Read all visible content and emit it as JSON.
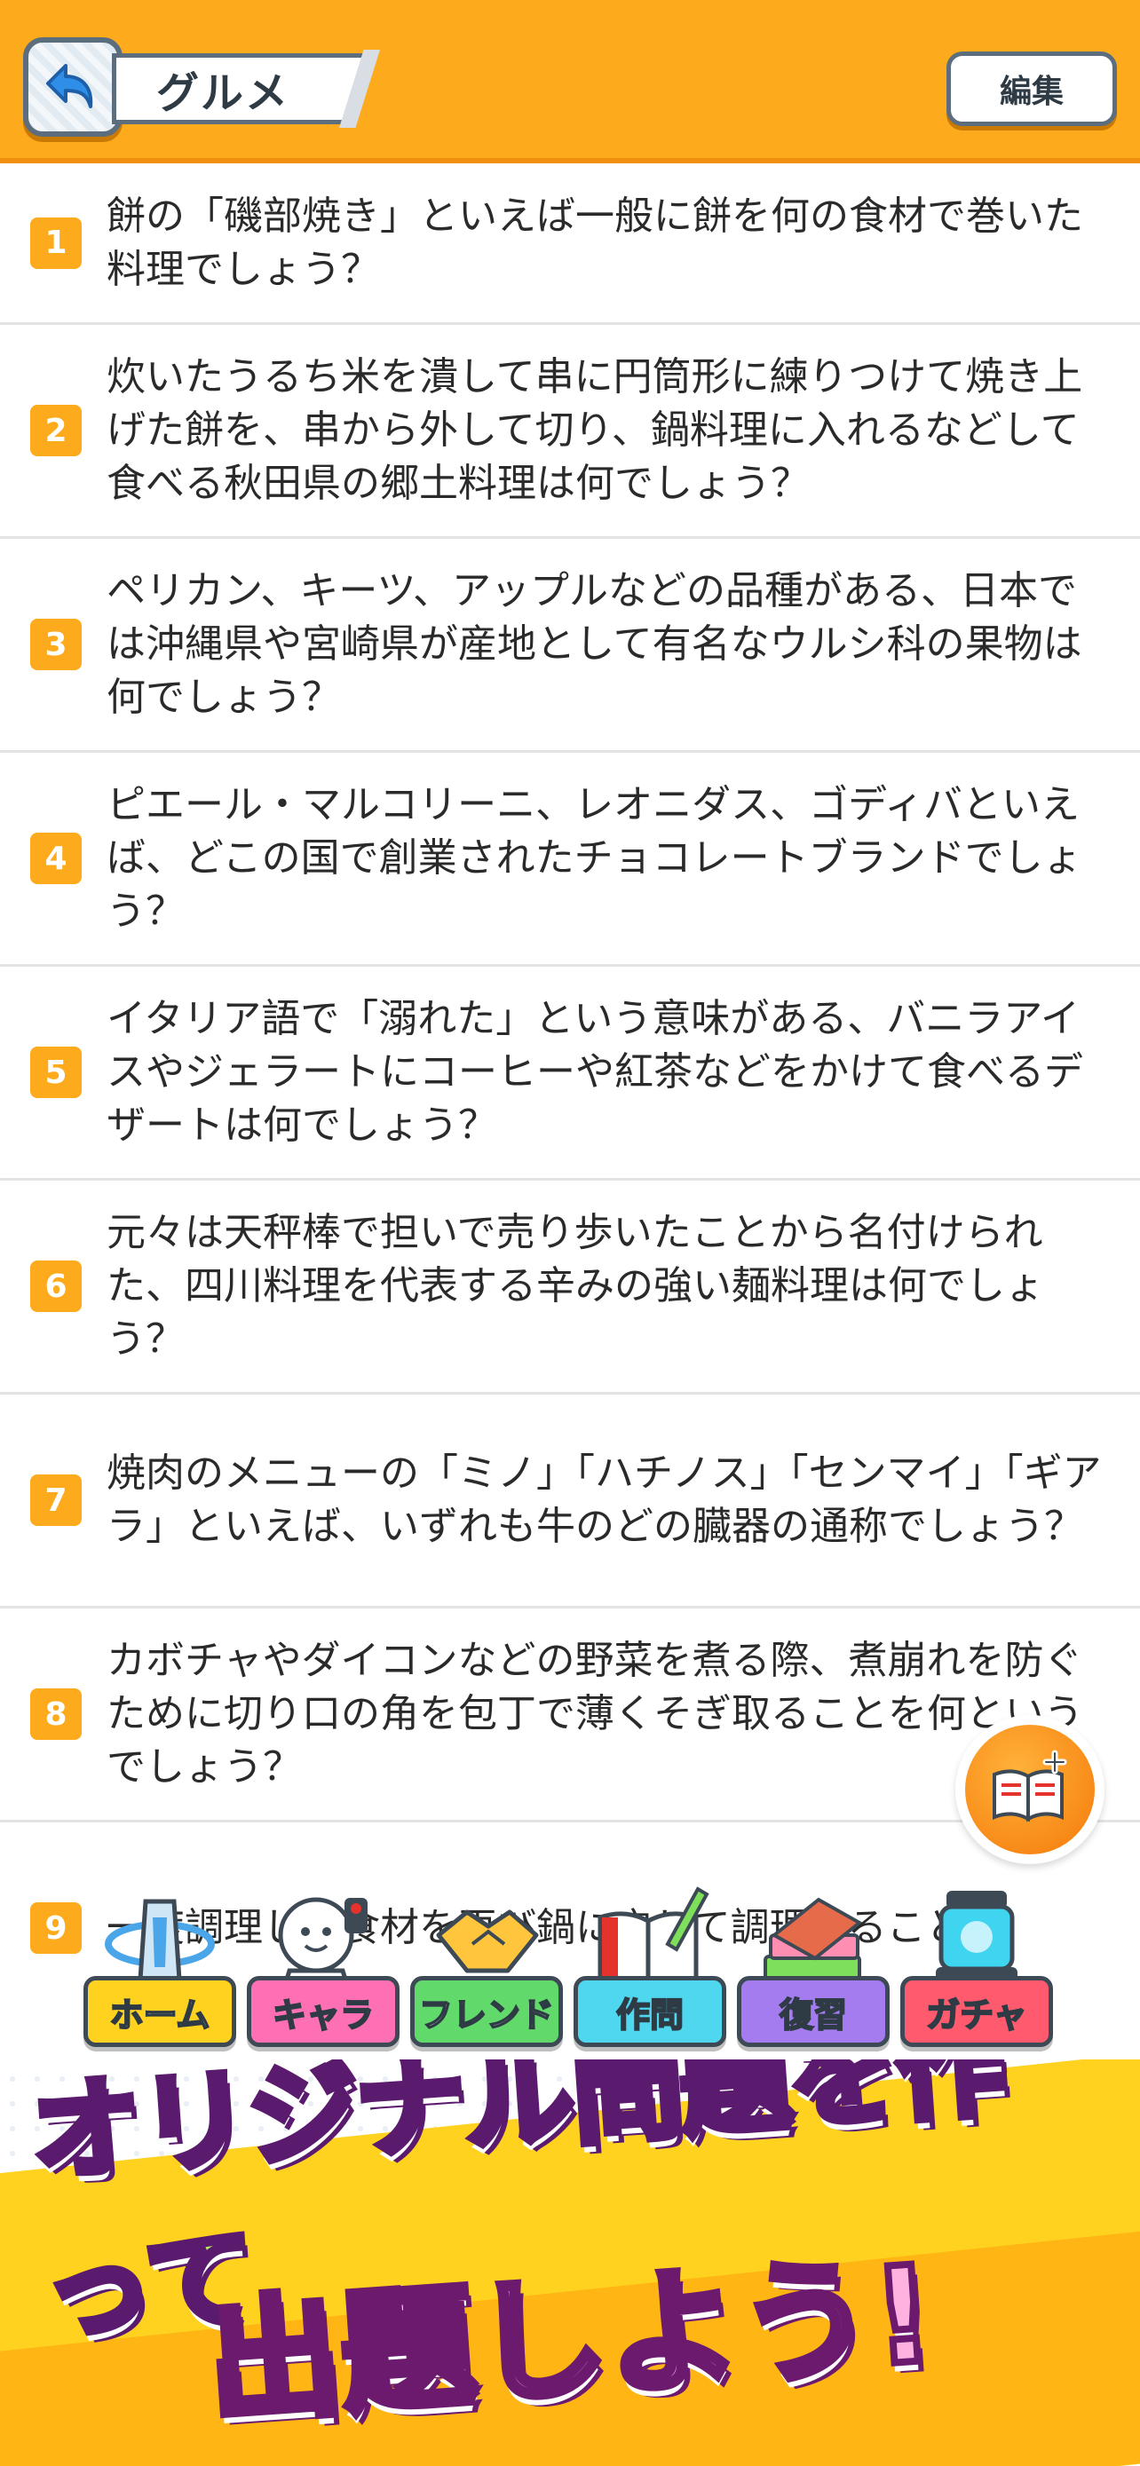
{
  "header": {
    "title": "グルメ",
    "edit_label": "編集"
  },
  "questions": [
    {
      "num": "1",
      "text": "餅の「磯部焼き」といえば一般に餅を何の食材で巻いた料理でしょう？"
    },
    {
      "num": "2",
      "text": "炊いたうるち米を潰して串に円筒形に練りつけて焼き上げた餅を、串から外して切り、鍋料理に入れるなどして食べる秋田県の郷土料理は何でしょう？"
    },
    {
      "num": "3",
      "text": "ペリカン、キーツ、アップルなどの品種がある、日本では沖縄県や宮崎県が産地として有名なウルシ科の果物は何でしょう？"
    },
    {
      "num": "4",
      "text": "ピエール・マルコリーニ、レオニダス、ゴディバといえば、どこの国で創業されたチョコレートブランドでしょう？"
    },
    {
      "num": "5",
      "text": "イタリア語で「溺れた」という意味がある、バニラアイスやジェラートにコーヒーや紅茶などをかけて食べるデザートは何でしょう？"
    },
    {
      "num": "6",
      "text": "元々は天秤棒で担いで売り歩いたことから名付けられた、四川料理を代表する辛みの強い麺料理は何でしょう？"
    },
    {
      "num": "7",
      "text": "焼肉のメニューの「ミノ」「ハチノス」「センマイ」「ギアラ」といえば、いずれも牛のどの臓器の通称でしょう？"
    },
    {
      "num": "8",
      "text": "カボチャやダイコンなどの野菜を煮る際、煮崩れを防ぐために切り口の角を包丁で薄くそぎ取ることを何というでしょう？"
    },
    {
      "num": "9",
      "text": "一度調理した食材を再び鍋に戻して調理することか"
    }
  ],
  "tabs": [
    {
      "label": "ホーム",
      "icon": "home-tower-icon",
      "color": "#ffd21f"
    },
    {
      "label": "キャラ",
      "icon": "character-icon",
      "color": "#ff6fb4"
    },
    {
      "label": "フレンド",
      "icon": "handshake-icon",
      "color": "#62d96b"
    },
    {
      "label": "作問",
      "icon": "notebook-pencil-icon",
      "color": "#4fd7f0"
    },
    {
      "label": "復習",
      "icon": "books-icon",
      "color": "#a57cf0"
    },
    {
      "label": "ガチャ",
      "icon": "gacha-capsule-icon",
      "color": "#ff5a6e"
    }
  ],
  "banner": {
    "line1": "オリジナル問題を作って",
    "line2": "出題しよう!"
  },
  "colors": {
    "accent": "#fdab1c",
    "header_border": "#ef8f0d",
    "divider": "#e3e3e3"
  }
}
